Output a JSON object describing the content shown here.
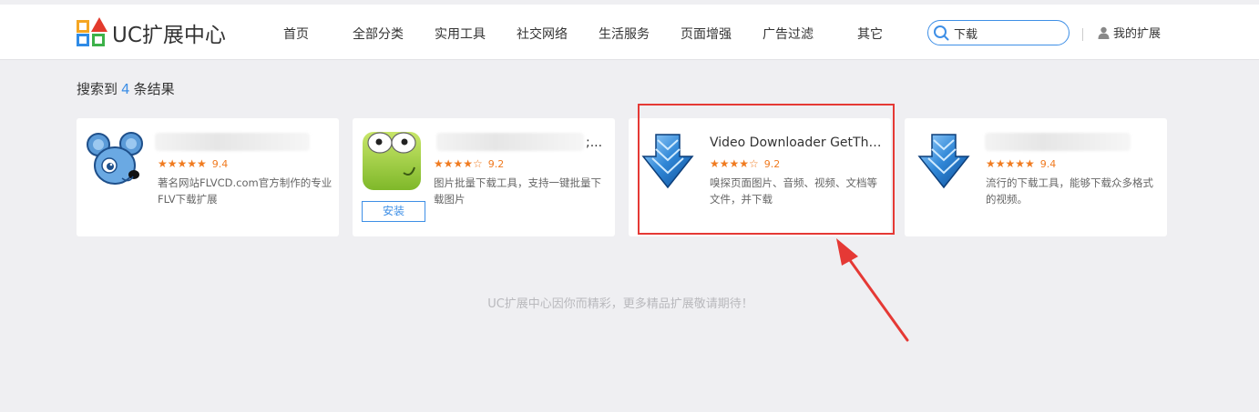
{
  "brand": {
    "name": "UC扩展中心"
  },
  "nav": {
    "items": [
      "首页",
      "全部分类",
      "实用工具",
      "社交网络",
      "生活服务",
      "页面增强",
      "广告过滤",
      "其它"
    ]
  },
  "search": {
    "value": "下载",
    "icon": "search-icon"
  },
  "user": {
    "label": "我的扩展",
    "icon": "user-icon"
  },
  "results": {
    "prefix": "搜索到",
    "count": "4",
    "suffix": "条结果"
  },
  "cards": [
    {
      "title": "",
      "stars": "★★★★★",
      "score": "9.4",
      "desc": "著名网站FLVCD.com官方制作的专业FLV下载扩展",
      "icon": "mouse-mascot-icon"
    },
    {
      "title": ";...",
      "stars": "★★★★☆",
      "score": "9.2",
      "desc": "图片批量下载工具，支持一键批量下载图片",
      "icon": "frog-eyes-icon",
      "install_label": "安装"
    },
    {
      "title": "Video Downloader GetThe...",
      "stars": "★★★★☆",
      "score": "9.2",
      "desc": "嗅探页面图片、音频、视频、文档等文件，并下载",
      "icon": "download-arrow-icon"
    },
    {
      "title": "",
      "stars": "★★★★★",
      "score": "9.4",
      "desc": "流行的下载工具，能够下载众多格式的视频。",
      "icon": "download-arrow-icon"
    }
  ],
  "footer": {
    "text": "UC扩展中心因你而精彩，更多精品扩展敬请期待！"
  },
  "colors": {
    "accent": "#3e8fe6",
    "star": "#f07b20",
    "highlight": "#e53935"
  }
}
